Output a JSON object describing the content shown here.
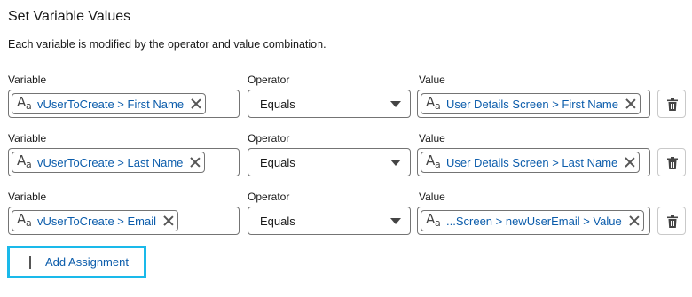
{
  "title": "Set Variable Values",
  "subtitle": "Each variable is modified by the operator and value combination.",
  "labels": {
    "variable": "Variable",
    "operator": "Operator",
    "value": "Value"
  },
  "rows": [
    {
      "variable": "vUserToCreate > First Name",
      "operator": "Equals",
      "value": "User Details Screen > First Name"
    },
    {
      "variable": "vUserToCreate > Last Name",
      "operator": "Equals",
      "value": "User Details Screen > Last Name"
    },
    {
      "variable": "vUserToCreate > Email",
      "operator": "Equals",
      "value": "...Screen > newUserEmail > Value"
    }
  ],
  "icons": {
    "type": "text-type-icon",
    "remove": "close-icon",
    "delete": "trash-icon",
    "add": "plus-icon",
    "dropdown": "chevron-down-icon"
  },
  "add_button_label": "Add Assignment",
  "colors": {
    "link": "#0b5cab",
    "highlight": "#1ab9ea",
    "border": "#747474"
  }
}
